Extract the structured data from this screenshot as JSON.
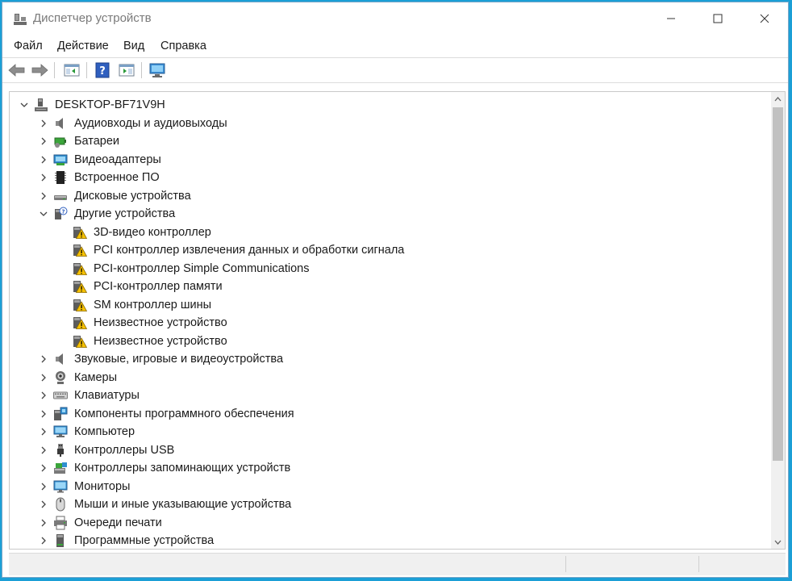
{
  "window": {
    "title": "Диспетчер устройств"
  },
  "menu": [
    "Файл",
    "Действие",
    "Вид",
    "Справка"
  ],
  "toolbar": [
    "back-icon",
    "forward-icon",
    "show-hide-console-tree-icon",
    "help-icon",
    "properties-panel-icon",
    "scan-hardware-monitor-icon"
  ],
  "tree": {
    "root": "DESKTOP-BF71V9H",
    "items": [
      {
        "label": "Аудиовходы и аудиовыходы",
        "icon": "speaker-icon",
        "expanded": false
      },
      {
        "label": "Батареи",
        "icon": "battery-icon",
        "expanded": false
      },
      {
        "label": "Видеоадаптеры",
        "icon": "display-adapter-icon",
        "expanded": false
      },
      {
        "label": "Встроенное ПО",
        "icon": "firmware-chip-icon",
        "expanded": false
      },
      {
        "label": "Дисковые устройства",
        "icon": "disk-drive-icon",
        "expanded": false
      },
      {
        "label": "Другие устройства",
        "icon": "other-devices-icon",
        "expanded": true,
        "children": [
          {
            "label": "3D-видео контроллер",
            "icon": "warning-device-icon"
          },
          {
            "label": "PCI контроллер извлечения данных и обработки сигнала",
            "icon": "warning-device-icon"
          },
          {
            "label": "PCI-контроллер Simple Communications",
            "icon": "warning-device-icon"
          },
          {
            "label": "PCI-контроллер памяти",
            "icon": "warning-device-icon"
          },
          {
            "label": "SM контроллер шины",
            "icon": "warning-device-icon"
          },
          {
            "label": "Неизвестное устройство",
            "icon": "warning-device-icon"
          },
          {
            "label": "Неизвестное устройство",
            "icon": "warning-device-icon"
          }
        ]
      },
      {
        "label": "Звуковые, игровые и видеоустройства",
        "icon": "speaker-icon",
        "expanded": false
      },
      {
        "label": "Камеры",
        "icon": "webcam-icon",
        "expanded": false
      },
      {
        "label": "Клавиатуры",
        "icon": "keyboard-icon",
        "expanded": false
      },
      {
        "label": "Компоненты программного обеспечения",
        "icon": "software-component-icon",
        "expanded": false
      },
      {
        "label": "Компьютер",
        "icon": "computer-icon",
        "expanded": false
      },
      {
        "label": "Контроллеры USB",
        "icon": "usb-icon",
        "expanded": false
      },
      {
        "label": "Контроллеры запоминающих устройств",
        "icon": "storage-controller-icon",
        "expanded": false
      },
      {
        "label": "Мониторы",
        "icon": "monitor-icon",
        "expanded": false
      },
      {
        "label": "Мыши и иные указывающие устройства",
        "icon": "mouse-icon",
        "expanded": false
      },
      {
        "label": "Очереди печати",
        "icon": "printer-icon",
        "expanded": false
      },
      {
        "label": "Программные устройства",
        "icon": "software-device-icon",
        "expanded": false
      }
    ]
  },
  "colors": {
    "accent": "#1b9fd6",
    "warning": "#f5c000"
  }
}
